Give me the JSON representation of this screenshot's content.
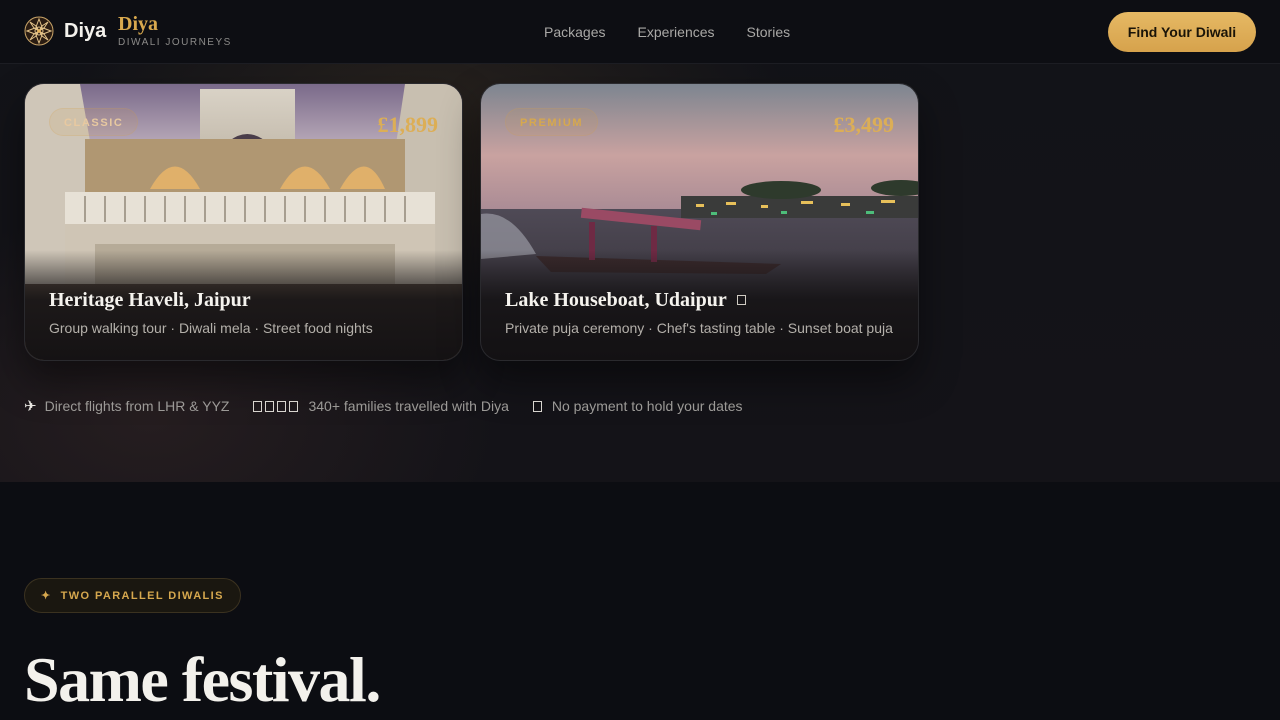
{
  "header": {
    "logo_word": "Diya",
    "brand_name": "Diya",
    "brand_tagline": "DIWALI JOURNEYS",
    "nav": [
      "Packages",
      "Experiences",
      "Stories"
    ],
    "cta_label": "Find Your Diwali"
  },
  "cards": [
    {
      "tier": "CLASSIC",
      "price": "£1,899",
      "title": "Heritage Haveli, Jaipur",
      "features": "Group walking tour · Diwali mela · Street food nights",
      "scene_icon": "haveli-courtyard-photo"
    },
    {
      "tier": "PREMIUM",
      "price": "£3,499",
      "title": "Lake Houseboat, Udaipur",
      "features": "Private puja ceremony · Chef's tasting table · Sunset boat puja",
      "scene_icon": "lake-houseboat-photo"
    }
  ],
  "trust": {
    "flights": "Direct flights from LHR & YYZ",
    "families": "340+ families travelled with Diya",
    "payment": "No payment to hold your dates"
  },
  "section": {
    "eyebrow": "TWO PARALLEL DIWALIS",
    "heading": "Same festival."
  },
  "colors": {
    "accent": "#d9a94e",
    "background": "#0c0d12",
    "cta": "#e0b15a"
  }
}
